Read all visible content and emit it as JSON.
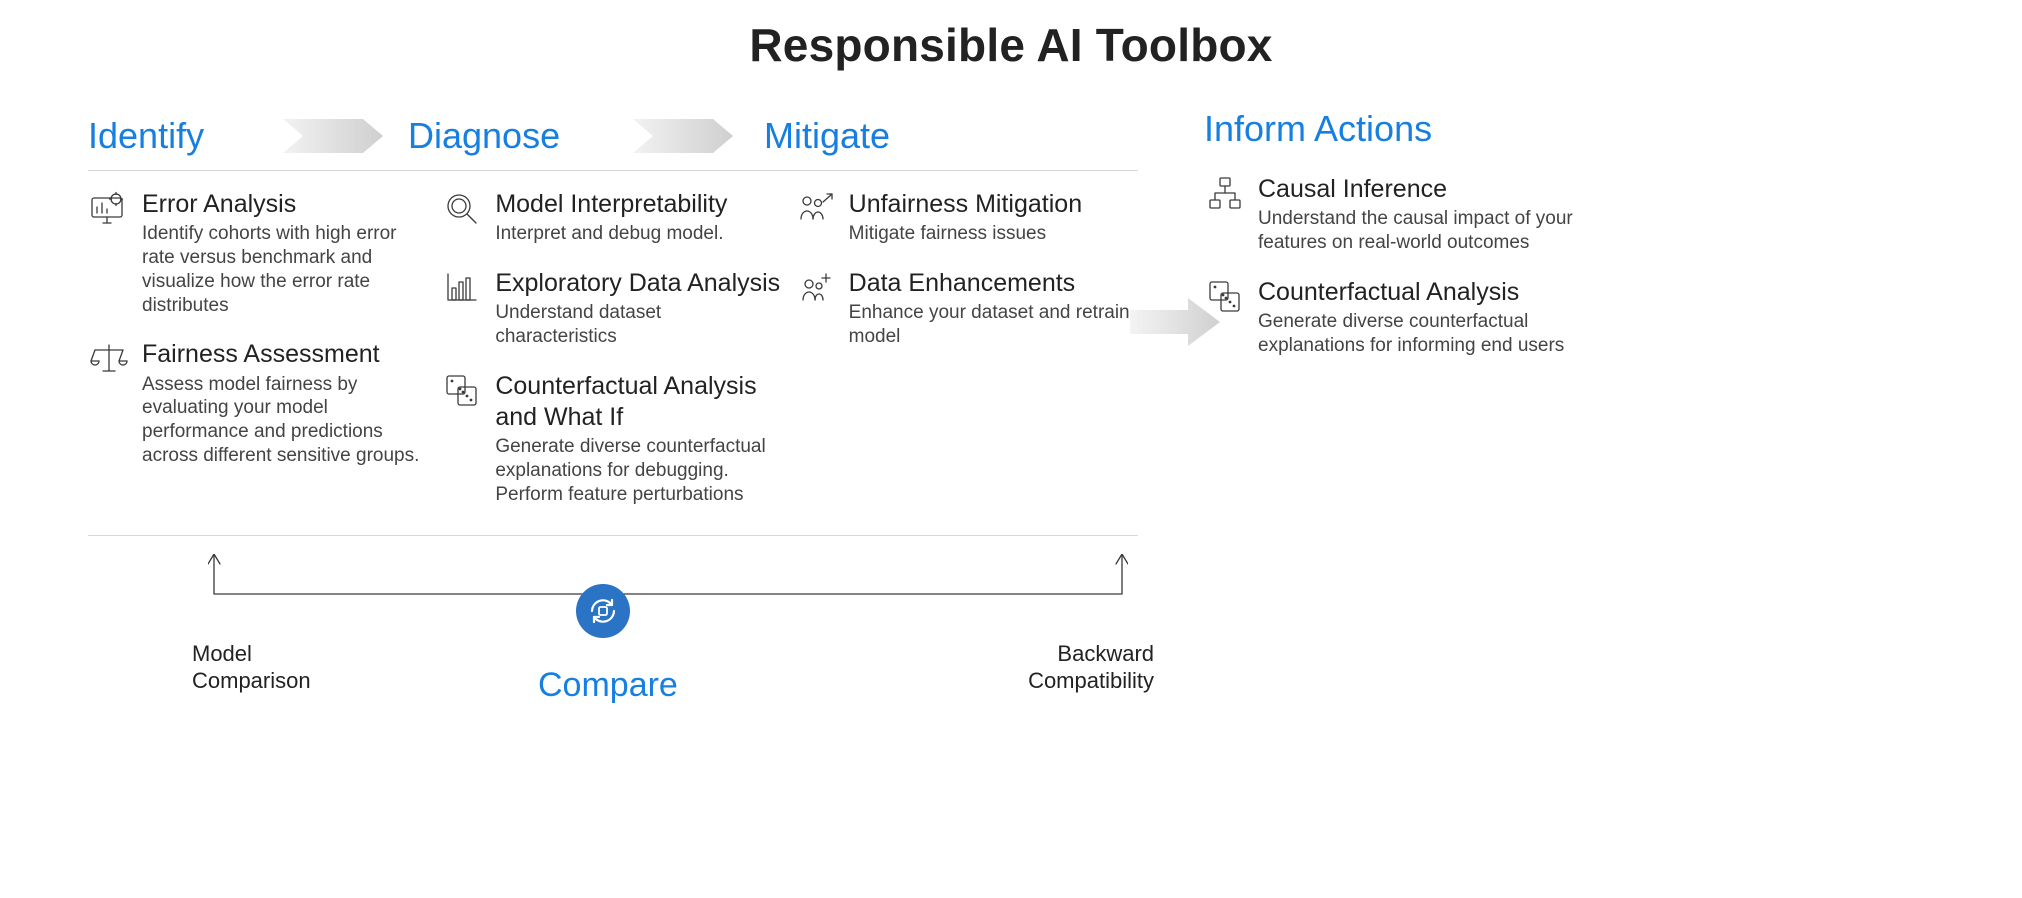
{
  "title": "Responsible AI Toolbox",
  "stages": {
    "identify": "Identify",
    "diagnose": "Diagnose",
    "mitigate": "Mitigate",
    "inform": "Inform Actions",
    "compare": "Compare"
  },
  "identify": {
    "error_analysis": {
      "title": "Error Analysis",
      "desc": "Identify cohorts with high error rate versus benchmark and visualize how the error rate distributes"
    },
    "fairness_assessment": {
      "title": "Fairness Assessment",
      "desc": "Assess model fairness by evaluating your model performance and predictions across different sensitive groups."
    }
  },
  "diagnose": {
    "model_interpretability": {
      "title": "Model Interpretability",
      "desc": "Interpret and debug model."
    },
    "eda": {
      "title": "Exploratory Data Analysis",
      "desc": "Understand dataset characteristics"
    },
    "counterfactual": {
      "title": "Counterfactual Analysis and What If",
      "desc": "Generate diverse counterfactual explanations for debugging. Perform feature perturbations"
    }
  },
  "mitigate": {
    "unfairness": {
      "title": "Unfairness Mitigation",
      "desc": "Mitigate fairness issues"
    },
    "data_enhance": {
      "title": "Data Enhancements",
      "desc": "Enhance your dataset and retrain model"
    }
  },
  "inform": {
    "causal": {
      "title": "Causal Inference",
      "desc": "Understand the causal impact of your features on real-world outcomes"
    },
    "counterfactual": {
      "title": "Counterfactual Analysis",
      "desc": "Generate diverse counterfactual explanations for informing end users"
    }
  },
  "compare": {
    "model_comparison": "Model Comparison",
    "backward_compat": "Backward Compatibility"
  },
  "colors": {
    "accent": "#167fe0",
    "text": "#222222",
    "rule": "#d8d8d8"
  }
}
